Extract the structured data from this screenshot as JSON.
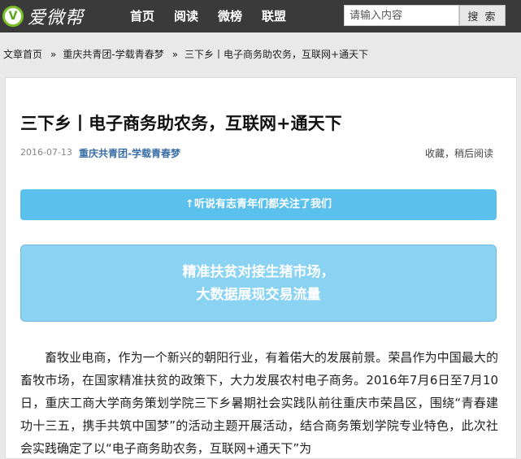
{
  "header": {
    "logo_mark": "V",
    "logo_text": "爱微帮",
    "nav": [
      "首页",
      "阅读",
      "微榜",
      "联盟"
    ],
    "search_placeholder": "请输入内容",
    "search_button": "搜 索"
  },
  "breadcrumb": {
    "items": [
      "文章首页",
      "重庆共青团-学载青春梦",
      "三下乡丨电子商务助农务，互联网+通天下"
    ],
    "separator": "»"
  },
  "article": {
    "title": "三下乡丨电子商务助农务，互联网+通天下",
    "date": "2016-07-13",
    "source": "重庆共青团-学载青春梦",
    "later": "收藏，稍后阅读",
    "follow_bar": "↑听说有志青年们都关注了我们",
    "banner_lines": [
      "精准扶贫对接生猪市场，",
      "大数据展现交易流量"
    ],
    "body": "畜牧业电商，作为一个新兴的朝阳行业，有着偌大的发展前景。荣昌作为中国最大的畜牧市场，在国家精准扶贫的政策下，大力发展农村电子商务。2016年7月6日至7月10日，重庆工商大学商务策划学院三下乡暑期社会实践队前往重庆市荣昌区，围绕“青春建功十三五，携手共筑中国梦”的活动主题开展活动，结合商务策划学院专业特色，此次社会实践确定了以“电子商务助农务，互联网+通天下”为"
  },
  "colors": {
    "topbar": "#3a3a3a",
    "logo_green": "#7cbd2a",
    "follow_bar": "#5bc0eb",
    "banner": "#8ad3f3",
    "source_link": "#3a6ea5"
  }
}
